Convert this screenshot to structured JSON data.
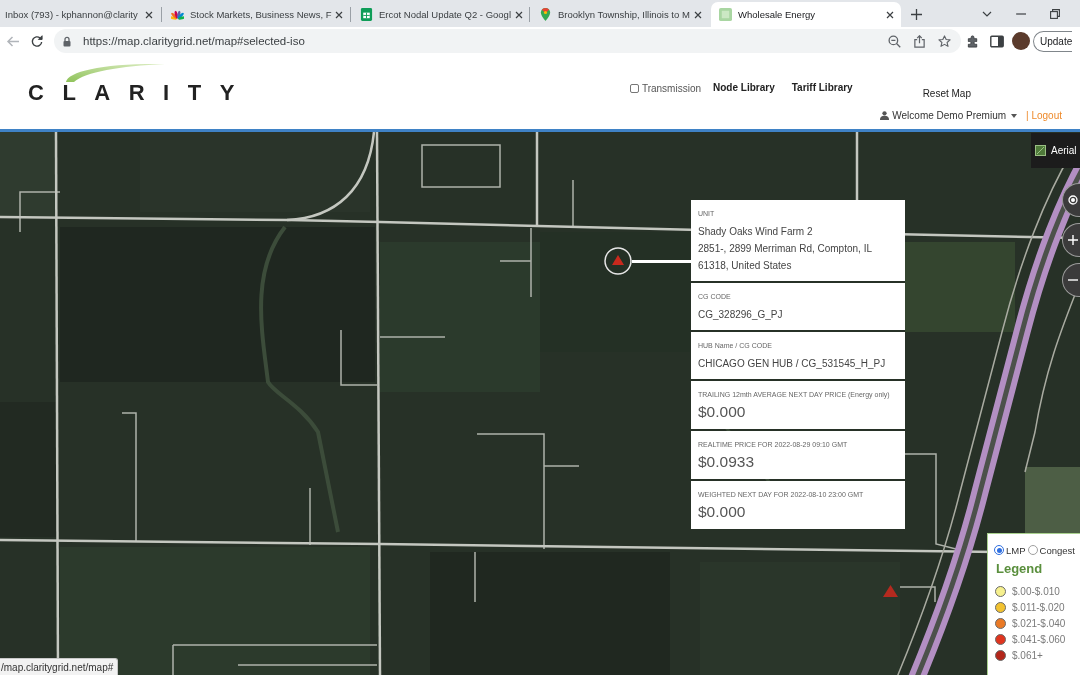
{
  "browser": {
    "tabs": [
      {
        "title": "Inbox (793) - kphannon@clarity",
        "selected": false
      },
      {
        "title": "Stock Markets, Business News, F",
        "selected": false
      },
      {
        "title": "Ercot Nodal Update Q2 - Googl",
        "selected": false
      },
      {
        "title": "Brooklyn Township, Illinois to M",
        "selected": false
      },
      {
        "title": "Wholesale Energy",
        "selected": true
      }
    ],
    "back_button": {
      "disabled": true
    },
    "url": "https://map.claritygrid.net/map#selected-iso",
    "update_button": "Update"
  },
  "header": {
    "logo": "CLARITY",
    "transmission": {
      "label": "Transmission",
      "checked": false
    },
    "links": [
      "Node Library",
      "Tariff Library"
    ],
    "reset_map": "Reset Map",
    "user_menu": "Welcome Demo Premium",
    "logout": "| Logout"
  },
  "map": {
    "map_type": "Aerial",
    "popup": {
      "sections": [
        {
          "kind": "text",
          "label": "UNIT",
          "lines": [
            "Shady Oaks Wind Farm 2",
            "2851-, 2899 Merriman Rd, Compton, IL",
            "61318, United States"
          ]
        },
        {
          "kind": "text",
          "label": "CG CODE",
          "lines": [
            "CG_328296_G_PJ"
          ]
        },
        {
          "kind": "text",
          "label": "HUB Name / CG CODE",
          "lines": [
            "CHICAGO GEN HUB / CG_531545_H_PJ"
          ]
        },
        {
          "kind": "price",
          "label": "TRAILING 12mth AVERAGE NEXT DAY PRICE (Energy only)",
          "value": "$0.000"
        },
        {
          "kind": "price",
          "label": "REALTIME PRICE FOR 2022-08-29 09:10 GMT",
          "value": "$0.0933"
        },
        {
          "kind": "price",
          "label": "WEIGHTED NEXT DAY FOR 2022-08-10 23:00 GMT",
          "value": "$0.000"
        }
      ]
    },
    "legend": {
      "modes": [
        {
          "label": "LMP",
          "selected": true
        },
        {
          "label": "Congest",
          "selected": false
        }
      ],
      "title": "Legend",
      "items": [
        {
          "label": "$.00-$.010",
          "color": "#f6f08e"
        },
        {
          "label": "$.011-$.020",
          "color": "#f2c230"
        },
        {
          "label": "$.021-$.040",
          "color": "#ea7a26"
        },
        {
          "label": "$.041-$.060",
          "color": "#e0341e"
        },
        {
          "label": "$.061+",
          "color": "#b3261a"
        }
      ]
    },
    "status_url": "/map.claritygrid.net/map#"
  }
}
